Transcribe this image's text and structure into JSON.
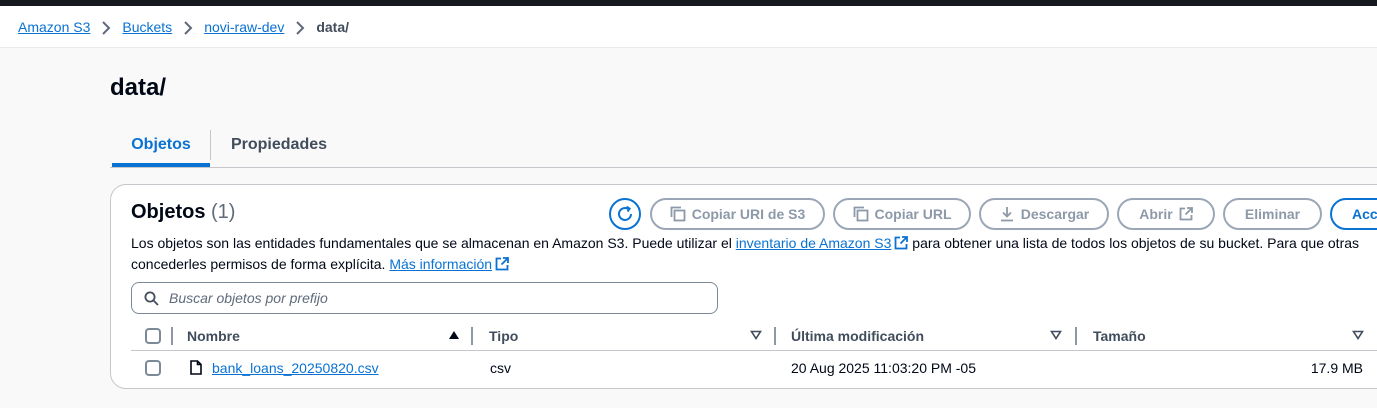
{
  "breadcrumb": {
    "items": [
      "Amazon S3",
      "Buckets",
      "novi-raw-dev"
    ],
    "current": "data/"
  },
  "page": {
    "title": "data/"
  },
  "tabs": [
    {
      "label": "Objetos",
      "active": true
    },
    {
      "label": "Propiedades",
      "active": false
    }
  ],
  "objects_panel": {
    "title": "Objetos",
    "count": "(1)",
    "description_part1": "Los objetos son las entidades fundamentales que se almacenan en Amazon S3. Puede utilizar el ",
    "inventory_link": "inventario de Amazon S3",
    "description_part2": " para obtener una lista de todos los objetos de su bucket. Para que otras",
    "description_part3": "concederles permisos de forma explícita. ",
    "more_info_link": "Más información",
    "buttons": {
      "refresh_icon": "refresh-icon",
      "copy_uri": "Copiar URI de S3",
      "copy_url": "Copiar URL",
      "download": "Descargar",
      "open": "Abrir",
      "delete": "Eliminar",
      "actions": "Acci"
    },
    "search_placeholder": "Buscar objetos por prefijo",
    "columns": [
      "Nombre",
      "Tipo",
      "Última modificación",
      "Tamaño"
    ],
    "rows": [
      {
        "name": "bank_loans_20250820.csv",
        "type": "csv",
        "modified": "20 Aug 2025 11:03:20 PM -05",
        "size": "17.9 MB"
      }
    ]
  },
  "colors": {
    "accent": "#0972d3",
    "disabled": "#8d99a8",
    "text": "#000716",
    "topbar": "#16191f"
  }
}
